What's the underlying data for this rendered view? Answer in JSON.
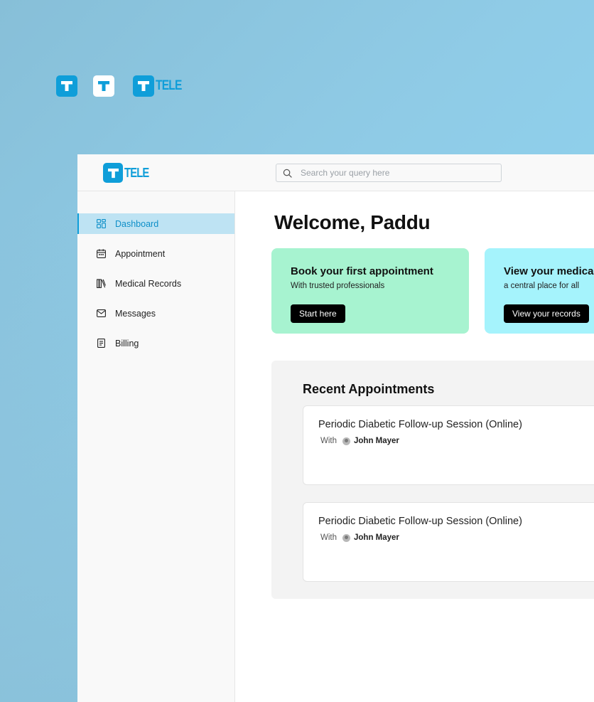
{
  "brand": {
    "wordmark": "TELE",
    "accent": "#0f9ed9"
  },
  "search": {
    "placeholder": "Search your query here",
    "icon": "search-icon"
  },
  "sidebar": {
    "items": [
      {
        "label": "Dashboard",
        "icon": "dashboard-grid-icon",
        "active": true
      },
      {
        "label": "Appointment",
        "icon": "calendar-icon",
        "active": false
      },
      {
        "label": "Medical Records",
        "icon": "library-books-icon",
        "active": false
      },
      {
        "label": "Messages",
        "icon": "envelope-icon",
        "active": false
      },
      {
        "label": "Billing",
        "icon": "receipt-icon",
        "active": false
      }
    ]
  },
  "main": {
    "welcome": "Welcome, Paddu",
    "cards": [
      {
        "title": "Book your first appointment",
        "subtitle": "With trusted professionals",
        "button": "Start here",
        "color": "#a7f3d0"
      },
      {
        "title": "View your medical",
        "subtitle": "a central place for all",
        "button": "View your records",
        "color": "#a5f3fc"
      }
    ],
    "recent": {
      "title": "Recent Appointments",
      "items": [
        {
          "title": "Periodic Diabetic Follow-up Session (Online)",
          "with_label": "With",
          "doctor": "John Mayer"
        },
        {
          "title": "Periodic Diabetic Follow-up Session (Online)",
          "with_label": "With",
          "doctor": "John Mayer"
        }
      ]
    }
  }
}
